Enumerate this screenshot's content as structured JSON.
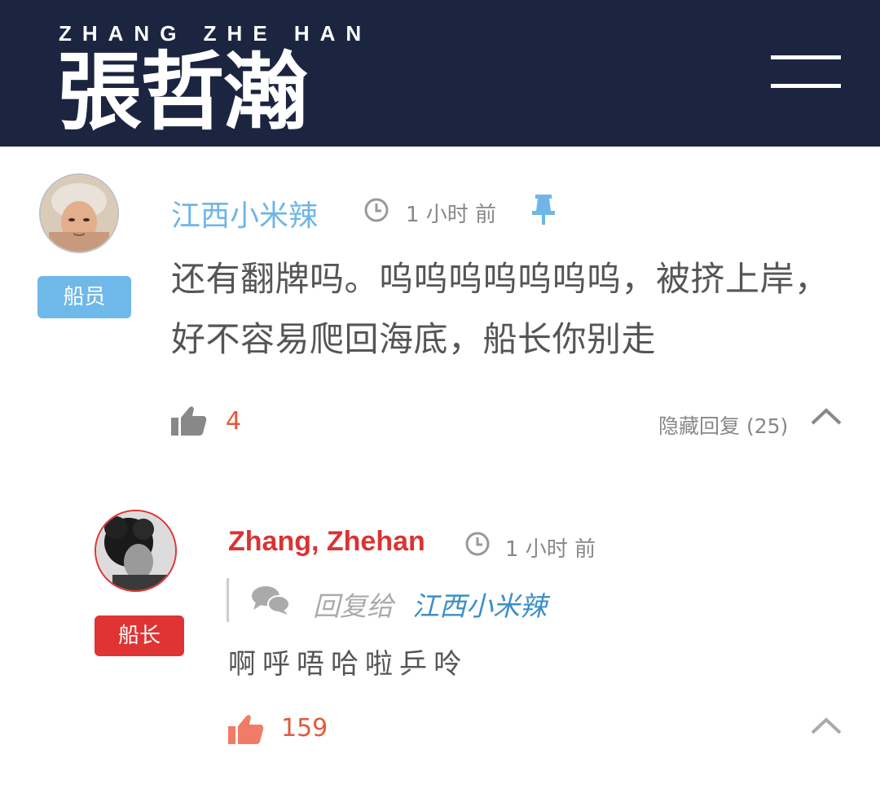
{
  "header": {
    "brand_en": "ZHANG ZHE HAN",
    "brand_cn": "張哲瀚",
    "menu_icon": "hamburger-menu-icon"
  },
  "comments": [
    {
      "author": "江西小米辣",
      "role_badge": "船员",
      "time": "1 小时 前",
      "pinned": true,
      "text": "还有翻牌吗。呜呜呜呜呜呜呜，被挤上岸，好不容易爬回海底，船长你别走",
      "likes": "4",
      "hide_replies_label": "隐藏回复",
      "reply_count": "(25)"
    },
    {
      "author": "Zhang, Zhehan",
      "role_badge": "船长",
      "time": "1 小时 前",
      "reply_prefix": "回复给",
      "reply_to": "江西小米辣",
      "text": "啊呼唔哈啦乒呤",
      "likes": "159"
    }
  ],
  "colors": {
    "header_bg": "#1b2540",
    "crew_badge": "#6fb9ea",
    "captain_badge": "#e03333",
    "like_count": "#e15a3c",
    "reply_link": "#3b8fc8"
  }
}
